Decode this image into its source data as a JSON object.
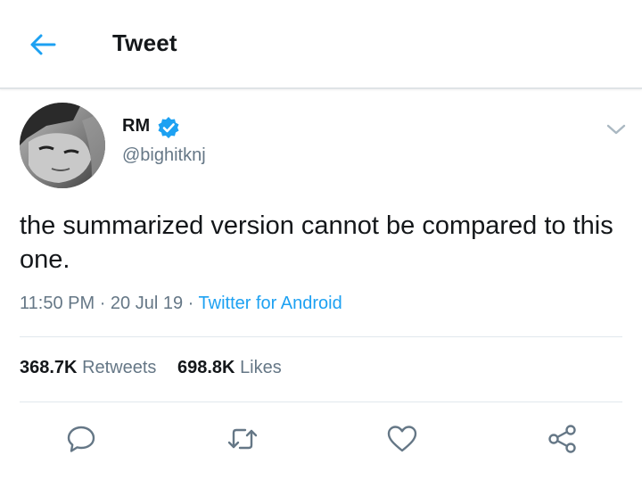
{
  "header": {
    "title": "Tweet",
    "back_icon": "arrow-left-icon",
    "accent_color": "#1da1f2"
  },
  "tweet": {
    "author": {
      "name": "RM",
      "handle": "@bighitknj",
      "verified": true
    },
    "text": "the summarized version cannot be compared to this one.",
    "time": "11:50 PM",
    "date": "20 Jul 19",
    "separator": "·",
    "source": "Twitter for Android",
    "stats": {
      "retweets_count": "368.7K",
      "retweets_label": "Retweets",
      "likes_count": "698.8K",
      "likes_label": "Likes"
    },
    "actions": [
      {
        "icon": "reply-icon"
      },
      {
        "icon": "retweet-icon"
      },
      {
        "icon": "like-icon"
      },
      {
        "icon": "share-icon"
      }
    ]
  },
  "colors": {
    "text": "#14171a",
    "secondary": "#657786",
    "link": "#1da1f2",
    "divider": "#e1e8ed"
  }
}
